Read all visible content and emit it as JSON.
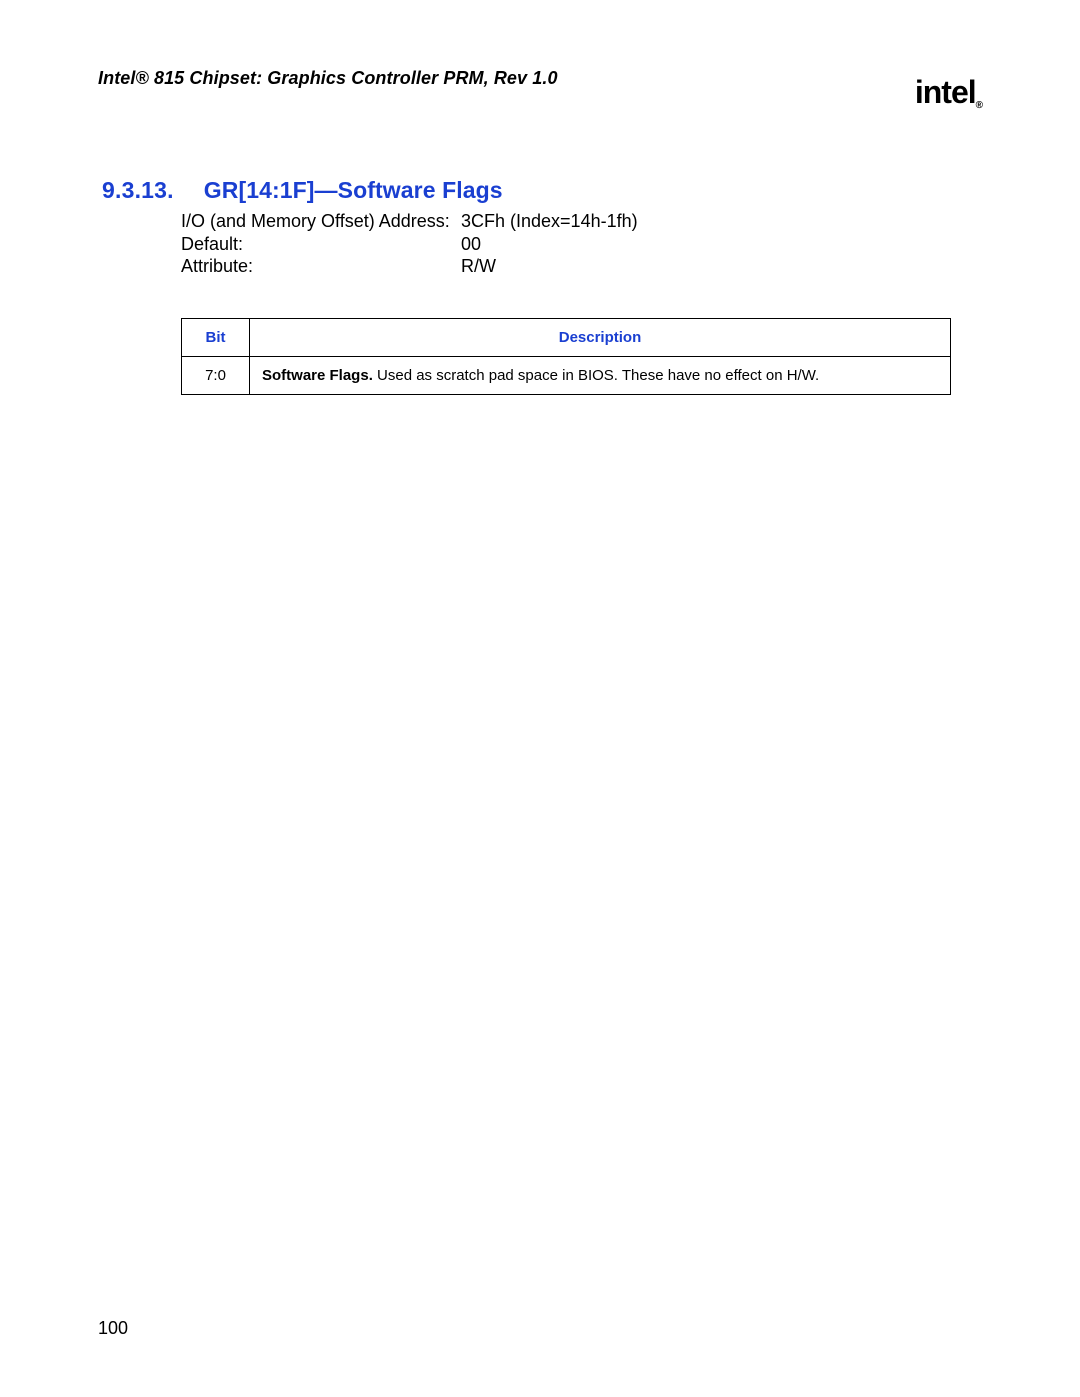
{
  "header": {
    "doc_title": "Intel® 815 Chipset: Graphics Controller PRM, Rev 1.0",
    "logo_text": "intel",
    "logo_subscript": "®"
  },
  "section": {
    "number": "9.3.13.",
    "title": "GR[14:1F]—Software Flags"
  },
  "meta": {
    "rows": [
      {
        "label": "I/O (and Memory Offset) Address:",
        "value": "3CFh (Index=14h-1fh)"
      },
      {
        "label": "Default:",
        "value": "00"
      },
      {
        "label": "Attribute:",
        "value": "R/W"
      }
    ]
  },
  "table": {
    "headers": {
      "bit": "Bit",
      "description": "Description"
    },
    "rows": [
      {
        "bit": "7:0",
        "desc_bold": "Software Flags.",
        "desc_rest": " Used as scratch pad space in BIOS. These have no effect on H/W."
      }
    ]
  },
  "page_number": "100"
}
